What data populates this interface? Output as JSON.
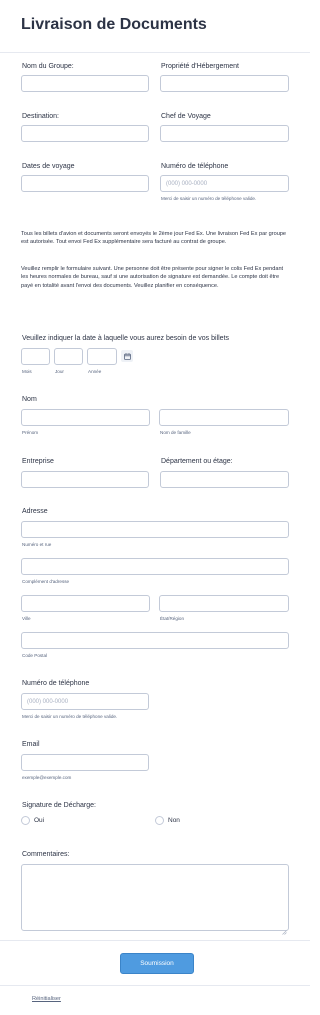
{
  "form": {
    "title": "Livraison de Documents",
    "group_name": {
      "label": "Nom du Groupe:",
      "value": ""
    },
    "hosting": {
      "label": "Propriété d'Hébergement",
      "value": ""
    },
    "destination": {
      "label": "Destination:",
      "value": ""
    },
    "trip_leader": {
      "label": "Chef de Voyage",
      "value": ""
    },
    "travel_dates": {
      "label": "Dates de voyage",
      "value": ""
    },
    "phone_top": {
      "label": "Numéro de téléphone",
      "placeholder": "(000) 000-0000",
      "hint": "Merci de saisir un numéro de téléphone valide."
    },
    "paragraph1": "Tous les billets d'avion et documents seront envoyés le 2ème jour Fed Ex. Une livraison Fed Ex par groupe est autorisée. Tout envoi Fed Ex supplémentaire sera facturé au contrat de groupe.",
    "paragraph2": "Veuillez remplir le formulaire suivant. Une personne doit être présente pour signer le colis Fed Ex pendant les heures normales de bureau, sauf si une autorisation de signature est demandée. Le compte doit être payé en totalité avant l'envoi des documents. Veuillez planifier en conséquence.",
    "date_needed": {
      "label": "Veuillez indiquer la date à laquelle vous aurez besoin de vos billets",
      "month": "Mois",
      "day": "Jour",
      "year": "Année"
    },
    "name": {
      "label": "Nom",
      "first": "Prénom",
      "last": "Nom de famille"
    },
    "company": {
      "label": "Entreprise"
    },
    "department": {
      "label": "Département ou étage:"
    },
    "address": {
      "label": "Adresse",
      "street": "Numéro et rue",
      "street2": "Complément d'adresse",
      "city": "Ville",
      "state": "État/Région",
      "postal": "Code Postal"
    },
    "phone": {
      "label": "Numéro de téléphone",
      "placeholder": "(000) 000-0000",
      "hint": "Merci de saisir un numéro de téléphone valide."
    },
    "email": {
      "label": "Email",
      "hint": "exemple@exemple.com"
    },
    "signature": {
      "label": "Signature de Décharge:",
      "yes": "Oui",
      "no": "Non"
    },
    "comments": {
      "label": "Commentaires:",
      "value": ""
    },
    "submit_label": "Soumission",
    "reset_label": "Réinitialiser"
  },
  "colors": {
    "accent": "#4f9be0",
    "border": "#c3cad8",
    "text": "#2c3345"
  }
}
